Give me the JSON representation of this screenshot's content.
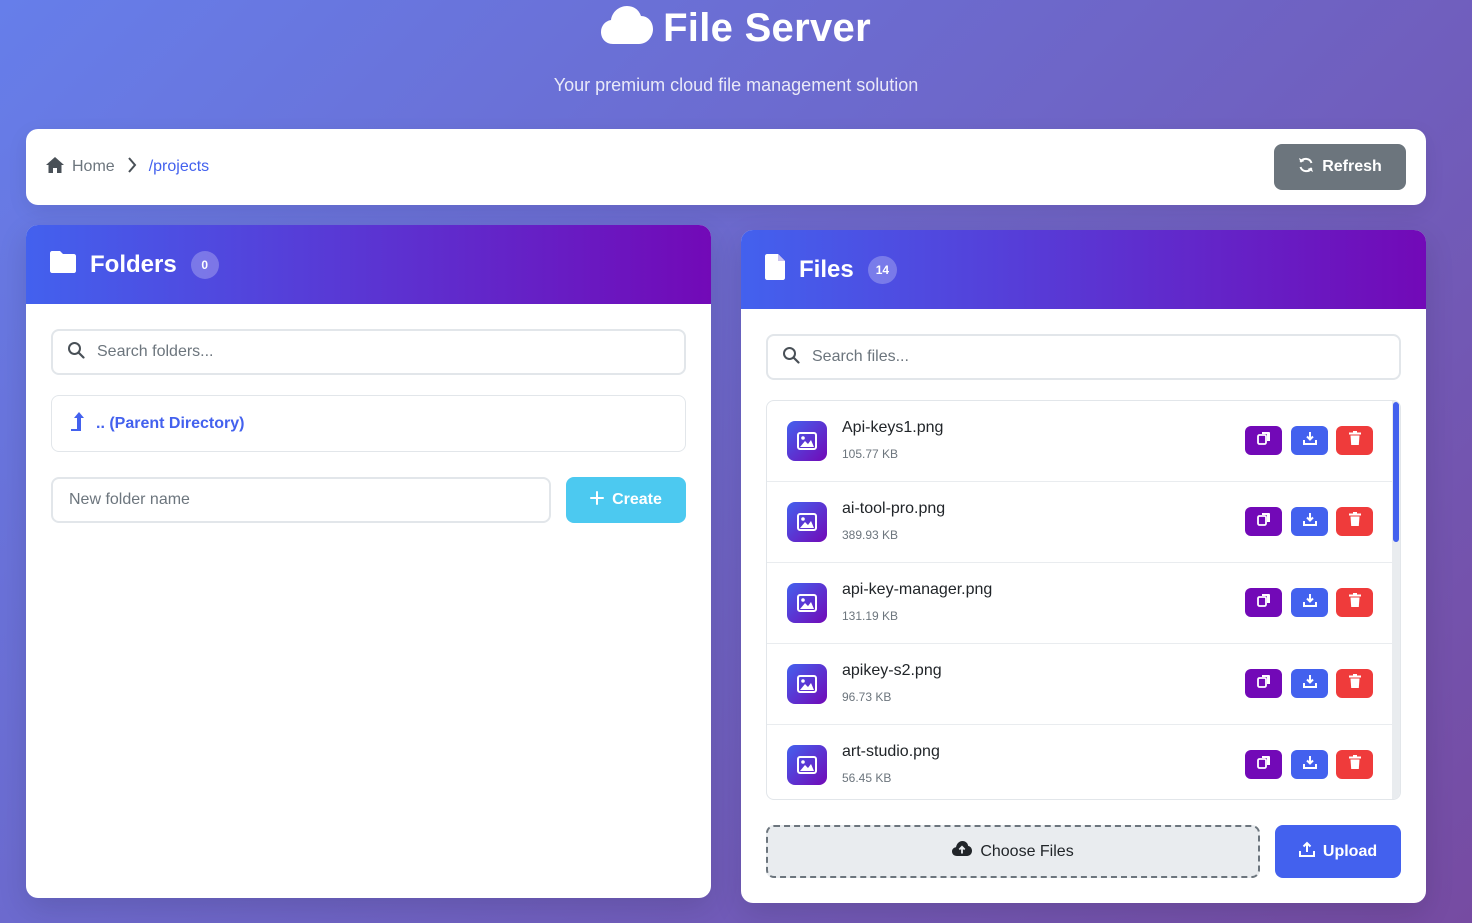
{
  "app": {
    "title": "File Server",
    "subtitle": "Your premium cloud file management solution"
  },
  "breadcrumb": {
    "home": "Home",
    "path": "/projects"
  },
  "toolbar": {
    "refresh_label": "Refresh"
  },
  "folders": {
    "title": "Folders",
    "count": "0",
    "search_placeholder": "Search folders...",
    "parent_label": ".. (Parent Directory)",
    "new_folder_placeholder": "New folder name",
    "create_label": "Create"
  },
  "files": {
    "title": "Files",
    "count": "14",
    "search_placeholder": "Search files...",
    "items": [
      {
        "name": "Api-keys1.png",
        "size": "105.77 KB"
      },
      {
        "name": "ai-tool-pro.png",
        "size": "389.93 KB"
      },
      {
        "name": "api-key-manager.png",
        "size": "131.19 KB"
      },
      {
        "name": "apikey-s2.png",
        "size": "96.73 KB"
      },
      {
        "name": "art-studio.png",
        "size": "56.45 KB"
      }
    ],
    "choose_label": "Choose Files",
    "upload_label": "Upload"
  },
  "colors": {
    "accent": "#4361ee",
    "secondary": "#7209b7",
    "danger": "#ef3b3b",
    "info": "#4cc9f0",
    "muted": "#6c757d"
  },
  "icons": {
    "header": "cloud-icon",
    "home": "home-icon",
    "separator": "chevron-right-icon",
    "refresh": "refresh-icon",
    "folder": "folder-icon",
    "file": "file-icon",
    "search": "search-icon",
    "parent": "level-up-icon",
    "create": "plus-icon",
    "image": "image-icon",
    "copy": "copy-icon",
    "download": "download-icon",
    "delete": "trash-icon",
    "choose": "cloud-upload-icon",
    "upload": "upload-icon"
  }
}
